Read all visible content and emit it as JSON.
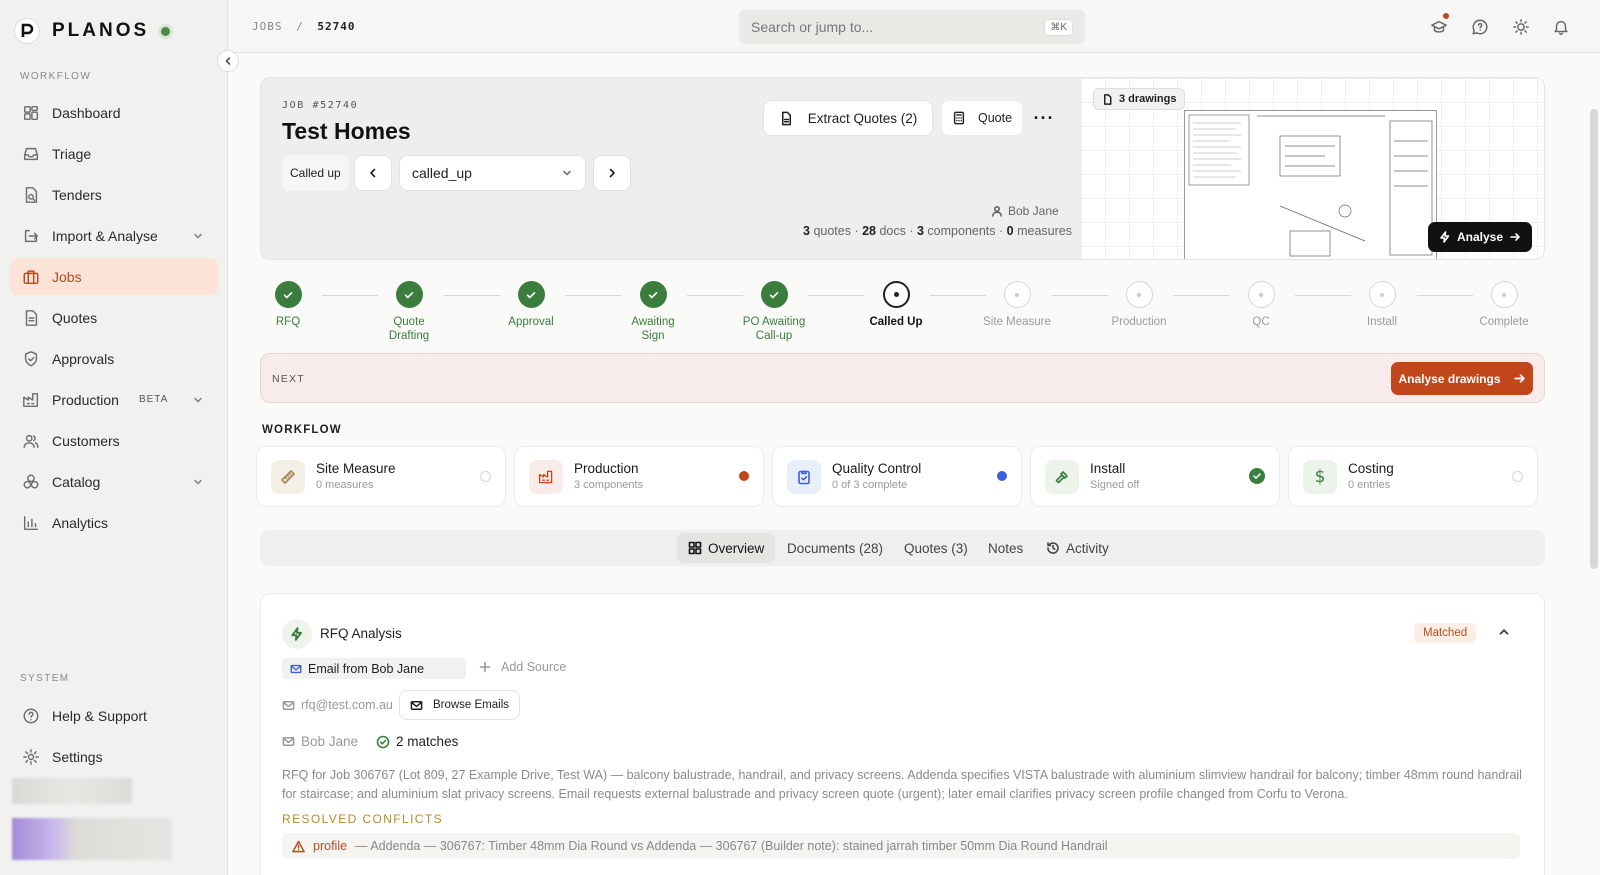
{
  "app": {
    "name": "PLANOS"
  },
  "sidebar": {
    "workflow_label": "WORKFLOW",
    "system_label": "SYSTEM",
    "items": [
      {
        "label": "Dashboard",
        "icon": "dashboard-icon"
      },
      {
        "label": "Triage",
        "icon": "inbox-icon"
      },
      {
        "label": "Tenders",
        "icon": "document-search-icon"
      },
      {
        "label": "Import & Analyse",
        "icon": "import-icon"
      },
      {
        "label": "Jobs",
        "icon": "briefcase-icon",
        "active": true
      },
      {
        "label": "Quotes",
        "icon": "document-icon"
      },
      {
        "label": "Approvals",
        "icon": "shield-check-icon"
      },
      {
        "label": "Production",
        "icon": "factory-icon",
        "badge": "BETA"
      },
      {
        "label": "Customers",
        "icon": "users-icon"
      },
      {
        "label": "Catalog",
        "icon": "boxes-icon"
      },
      {
        "label": "Analytics",
        "icon": "bar-chart-icon"
      }
    ],
    "system_items": [
      {
        "label": "Help & Support",
        "icon": "help-circle-icon"
      },
      {
        "label": "Settings",
        "icon": "gear-icon"
      }
    ]
  },
  "topbar": {
    "breadcrumb_root": "JOBS",
    "breadcrumb_sep": "/",
    "breadcrumb_current": "52740",
    "search_placeholder": "Search or jump to...",
    "search_shortcut": "⌘K"
  },
  "job": {
    "number_label": "JOB #52740",
    "title": "Test Homes",
    "status_chip": "Called up",
    "status_select": "called_up",
    "extract_label": "Extract Quotes (2)",
    "quote_label": "Quote",
    "owner": "Bob Jane",
    "stats": {
      "quotes_n": "3",
      "quotes_l": "quotes",
      "docs_n": "28",
      "docs_l": "docs",
      "comp_n": "3",
      "comp_l": "components",
      "meas_n": "0",
      "meas_l": "measures"
    },
    "drawings_badge": "3 drawings",
    "analyse_label": "Analyse"
  },
  "stepper": [
    {
      "label": "RFQ",
      "state": "done"
    },
    {
      "label": "Quote Drafting",
      "state": "done"
    },
    {
      "label": "Approval",
      "state": "done"
    },
    {
      "label": "Awaiting Sign",
      "state": "done"
    },
    {
      "label": "PO Awaiting Call-up",
      "state": "done"
    },
    {
      "label": "Called Up",
      "state": "current"
    },
    {
      "label": "Site Measure",
      "state": "todo"
    },
    {
      "label": "Production",
      "state": "todo"
    },
    {
      "label": "QC",
      "state": "todo"
    },
    {
      "label": "Install",
      "state": "todo"
    },
    {
      "label": "Complete",
      "state": "todo"
    }
  ],
  "next": {
    "label": "NEXT",
    "button": "Analyse drawings"
  },
  "workflow": {
    "title": "WORKFLOW",
    "cards": [
      {
        "name": "Site Measure",
        "sub": "0 measures",
        "icon": "ruler-icon",
        "status": "empty"
      },
      {
        "name": "Production",
        "sub": "3 components",
        "icon": "factory-icon",
        "status": "red"
      },
      {
        "name": "Quality Control",
        "sub": "0 of 3 complete",
        "icon": "clipboard-check-icon",
        "status": "blue"
      },
      {
        "name": "Install",
        "sub": "Signed off",
        "icon": "hammer-icon",
        "status": "done"
      },
      {
        "name": "Costing",
        "sub": "0 entries",
        "icon": "dollar-icon",
        "status": "empty"
      }
    ]
  },
  "tabs": [
    {
      "label": "Overview",
      "icon": "grid-icon",
      "active": true
    },
    {
      "label": "Documents (28)"
    },
    {
      "label": "Quotes (3)"
    },
    {
      "label": "Notes"
    },
    {
      "label": "Activity",
      "icon": "history-icon"
    }
  ],
  "rfq": {
    "title": "RFQ Analysis",
    "status": "Matched",
    "source_chip": "Email from Bob Jane",
    "add_source": "Add Source",
    "email": "rfq@test.com.au",
    "browse_emails": "Browse Emails",
    "contact": "Bob Jane",
    "matches": "2 matches",
    "description": "RFQ for Job 306767 (Lot 809, 27 Example Drive, Test WA) — balcony balustrade, handrail, and privacy screens. Addenda specifies VISTA balustrade with aluminium slimview handrail for balcony; timber 48mm round handrail for staircase; and aluminium slat privacy screens. Email requests external balustrade and privacy screen quote (urgent); later email clarifies privacy screen profile changed from Corfu to Verona.",
    "resolved_label": "RESOLVED CONFLICTS",
    "conflict_key": "profile",
    "conflict_text": "— Addenda — 306767: Timber 48mm Dia Round vs Addenda — 306767 (Builder note): stained jarrah timber 50mm Dia Round Handrail"
  },
  "colors": {
    "accent": "#c2461c",
    "active_bg": "#fbe3d7",
    "done_green": "#3a7d3c",
    "qc_blue": "#3b5fd9",
    "prod_red": "#c2461c"
  }
}
